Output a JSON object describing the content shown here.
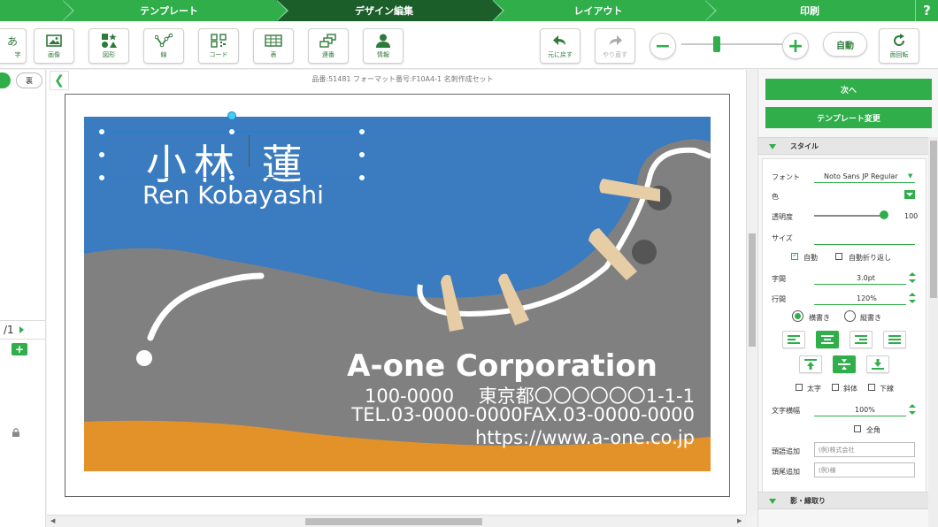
{
  "steps": [
    {
      "label": "テンプレート",
      "active": false
    },
    {
      "label": "デザイン編集",
      "active": true
    },
    {
      "label": "レイアウト",
      "active": false
    },
    {
      "label": "印刷",
      "active": false
    }
  ],
  "help_label": "?",
  "toolbar": {
    "partial_first_label": "字",
    "partial_first_glyph": "あ",
    "image": "画像",
    "shape": "図形",
    "line": "線",
    "code": "コード",
    "table": "表",
    "serial": "連番",
    "info": "情報",
    "undo": "元に戻す",
    "redo": "やり直す",
    "zoom_out": "−",
    "zoom_in": "+",
    "zoom_level": 0.35,
    "auto": "自動",
    "rotate": "面回転"
  },
  "left_panel": {
    "back_label": "裏",
    "page_indicator": "/1",
    "add_page": "+"
  },
  "product_info": "品番:51481 フォーマット番号:F10A4-1 名刺作成セット",
  "card": {
    "name": "小林 蓮",
    "name_roman": "Ren Kobayashi",
    "company": "A-one Corporation",
    "address": "100-0000　 東京都〇〇〇〇〇〇1-1-1",
    "tel_fax": "TEL.03-0000-0000FAX.03-0000-0000",
    "url": "https://www.a-one.co.jp"
  },
  "colors": {
    "accent": "#2fae4a",
    "accent_dark": "#1b5e2a",
    "card_blue": "#3b7bbf",
    "shoe_gray": "#808080",
    "sole_orange": "#e3922a",
    "spike_beige": "#e6cda6",
    "selection": "#2a7fd0"
  },
  "right_panel": {
    "next": "次へ",
    "change_template": "テンプレート変更",
    "style_section": "スタイル",
    "font_label": "フォント",
    "font_value": "Noto Sans JP Regular",
    "color_label": "色",
    "opacity_label": "透明度",
    "opacity_value": "100",
    "size_label": "サイズ",
    "size_auto": "自動",
    "size_auto_checked": true,
    "auto_wrap": "自動折り返し",
    "auto_wrap_checked": false,
    "letter_spacing_label": "字間",
    "letter_spacing_value": "3.0pt",
    "line_spacing_label": "行間",
    "line_spacing_value": "120%",
    "horizontal": "横書き",
    "vertical": "縦書き",
    "writing_mode": "横書き",
    "align_horizontal": [
      "left",
      "center",
      "right",
      "justify"
    ],
    "align_horizontal_active": "center",
    "align_vertical": [
      "top",
      "middle",
      "bottom"
    ],
    "align_vertical_active": "middle",
    "bold": "太字",
    "italic": "斜体",
    "underline": "下線",
    "char_width_label": "文字横幅",
    "char_width_value": "100%",
    "fullwidth": "全角",
    "prefix_label": "頭語追加",
    "prefix_placeholder": "(例)株式会社",
    "suffix_label": "頭尾追加",
    "suffix_placeholder": "(例)様",
    "shadow_section": "影・縁取り"
  }
}
